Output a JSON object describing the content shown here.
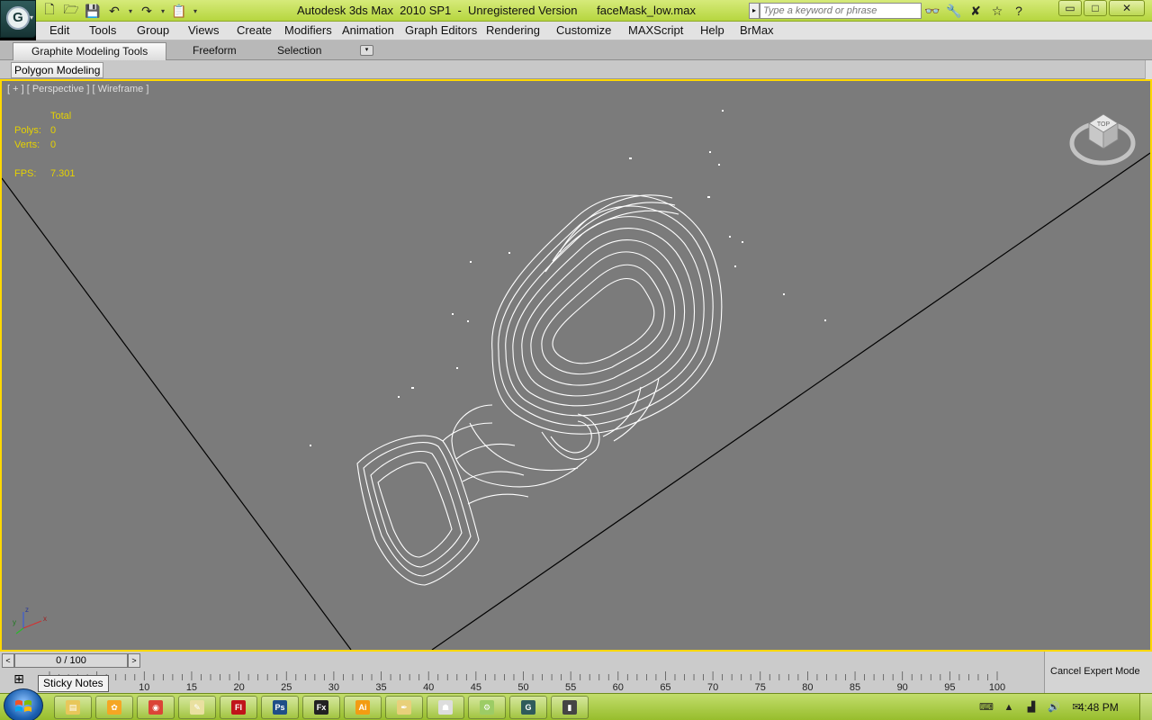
{
  "window": {
    "title": "Autodesk 3ds Max  2010 SP1  -  Unregistered Version      faceMask_low.max",
    "search_placeholder": "Type a keyword or phrase",
    "min": "▭",
    "max": "□",
    "close": "✕"
  },
  "app_button": {
    "logo": "G",
    "arrow": "▾"
  },
  "quick_access": [
    {
      "name": "new-file-icon",
      "glyph": "🗋"
    },
    {
      "name": "open-file-icon",
      "glyph": "🗁"
    },
    {
      "name": "save-icon",
      "glyph": "💾"
    },
    {
      "name": "undo-icon",
      "glyph": "↶"
    },
    {
      "name": "redo-icon",
      "glyph": "↷"
    },
    {
      "name": "project-folder-icon",
      "glyph": "📋"
    }
  ],
  "info_tools": [
    {
      "name": "binoculars-icon",
      "glyph": "👓"
    },
    {
      "name": "key-tools-icon",
      "glyph": "🔧"
    },
    {
      "name": "x-tools-icon",
      "glyph": "✘"
    },
    {
      "name": "favorite-star-icon",
      "glyph": "☆"
    },
    {
      "name": "help-icon",
      "glyph": "?"
    }
  ],
  "menu": [
    "Edit",
    "Tools",
    "Group",
    "Views",
    "Create",
    "Modifiers",
    "Animation",
    "Graph Editors",
    "Rendering",
    "Customize",
    "MAXScript",
    "Help",
    "BrMax"
  ],
  "ribbon": {
    "tabs": [
      "Graphite Modeling Tools",
      "Freeform",
      "Selection"
    ],
    "dropdown": "▾",
    "panel_button": "Polygon Modeling"
  },
  "viewport": {
    "label": "[ + ] [ Perspective ] [ Wireframe ]",
    "stats_header": "Total",
    "stats": [
      {
        "key": "Polys:",
        "value": "0"
      },
      {
        "key": "Verts:",
        "value": "0"
      }
    ],
    "fps_label": "FPS:",
    "fps_value": "7.301",
    "viewcube_label": "TOP",
    "axis": {
      "x": "x",
      "y": "y",
      "z": "z"
    },
    "colors": {
      "background": "#7b7b7b",
      "border_active": "#ffd800",
      "stats": "#e6d200",
      "wireframe": "#ffffff"
    }
  },
  "timeline": {
    "frame_display": "0 / 100",
    "prev": "<",
    "next": ">",
    "ticks": [
      10,
      15,
      20,
      25,
      30,
      35,
      40,
      45,
      50,
      55,
      60,
      65,
      70,
      75,
      80,
      85,
      90,
      95,
      100
    ],
    "frame_range": [
      0,
      100
    ],
    "tooltip": "Sticky Notes",
    "cancel_expert": "Cancel Expert Mode"
  },
  "taskbar": {
    "apps": [
      {
        "name": "taskbar-explorer",
        "label": "",
        "color": "#e8c75a",
        "glyph": "▤"
      },
      {
        "name": "taskbar-paint",
        "label": "",
        "color": "#f5a623",
        "glyph": "✿"
      },
      {
        "name": "taskbar-chrome",
        "label": "",
        "color": "#db4437",
        "glyph": "◉"
      },
      {
        "name": "taskbar-notepad",
        "label": "",
        "color": "#e9e0a0",
        "glyph": "✎"
      },
      {
        "name": "taskbar-flash",
        "label": "Fl",
        "color": "#c0141a",
        "glyph": "Fl"
      },
      {
        "name": "taskbar-photoshop",
        "label": "Ps",
        "color": "#1f4f87",
        "glyph": "Ps"
      },
      {
        "name": "taskbar-fireworks",
        "label": "Fx",
        "color": "#222222",
        "glyph": "Fx"
      },
      {
        "name": "taskbar-illustrator",
        "label": "Ai",
        "color": "#f39c12",
        "glyph": "Ai"
      },
      {
        "name": "taskbar-pen-tool",
        "label": "",
        "color": "#e8d07a",
        "glyph": "✒"
      },
      {
        "name": "taskbar-figure-app",
        "label": "",
        "color": "#dddddd",
        "glyph": "☗"
      },
      {
        "name": "taskbar-android",
        "label": "",
        "color": "#9ccc65",
        "glyph": "⚙"
      },
      {
        "name": "taskbar-3dsmax",
        "label": "",
        "color": "#2f5b5b",
        "glyph": "G"
      },
      {
        "name": "taskbar-film",
        "label": "",
        "color": "#444444",
        "glyph": "▮"
      }
    ],
    "tray": [
      {
        "name": "keyboard-icon",
        "glyph": "⌨"
      },
      {
        "name": "tray-up-arrow-icon",
        "glyph": "▲"
      },
      {
        "name": "signal-icon",
        "glyph": "▟"
      },
      {
        "name": "speaker-icon",
        "glyph": "🔊"
      },
      {
        "name": "mail-icon",
        "glyph": "✉"
      }
    ],
    "clock": "4:48 PM"
  }
}
